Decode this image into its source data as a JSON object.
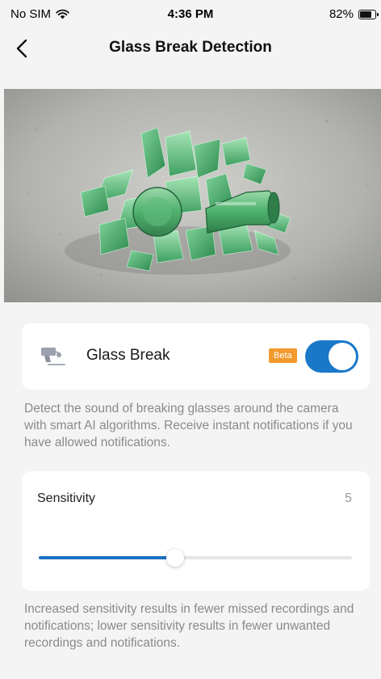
{
  "status_bar": {
    "carrier": "No SIM",
    "time": "4:36 PM",
    "battery_percent": "82%",
    "battery_level": 0.82,
    "wifi_icon": "wifi-icon",
    "battery_icon": "battery-icon"
  },
  "nav": {
    "title": "Glass Break Detection",
    "back_icon": "chevron-left-icon"
  },
  "hero_image": {
    "subject": "broken green glass bottle shards on concrete"
  },
  "glass_break": {
    "label": "Glass Break",
    "badge": "Beta",
    "enabled": true,
    "icon": "camera-icon",
    "description": "Detect the sound of breaking glasses around the camera with smart AI algorithms. Receive instant notifications if you have allowed notifications."
  },
  "sensitivity": {
    "label": "Sensitivity",
    "value": "5",
    "level": 0.435,
    "description": "Increased sensitivity results in fewer missed recordings and notifications; lower sensitivity results in fewer unwanted recordings and notifications."
  },
  "colors": {
    "accent": "#1A78C9",
    "badge": "#F39A2E",
    "background": "#F4F4F4",
    "card": "#FFFFFF",
    "muted_text": "#8A8A8A"
  }
}
